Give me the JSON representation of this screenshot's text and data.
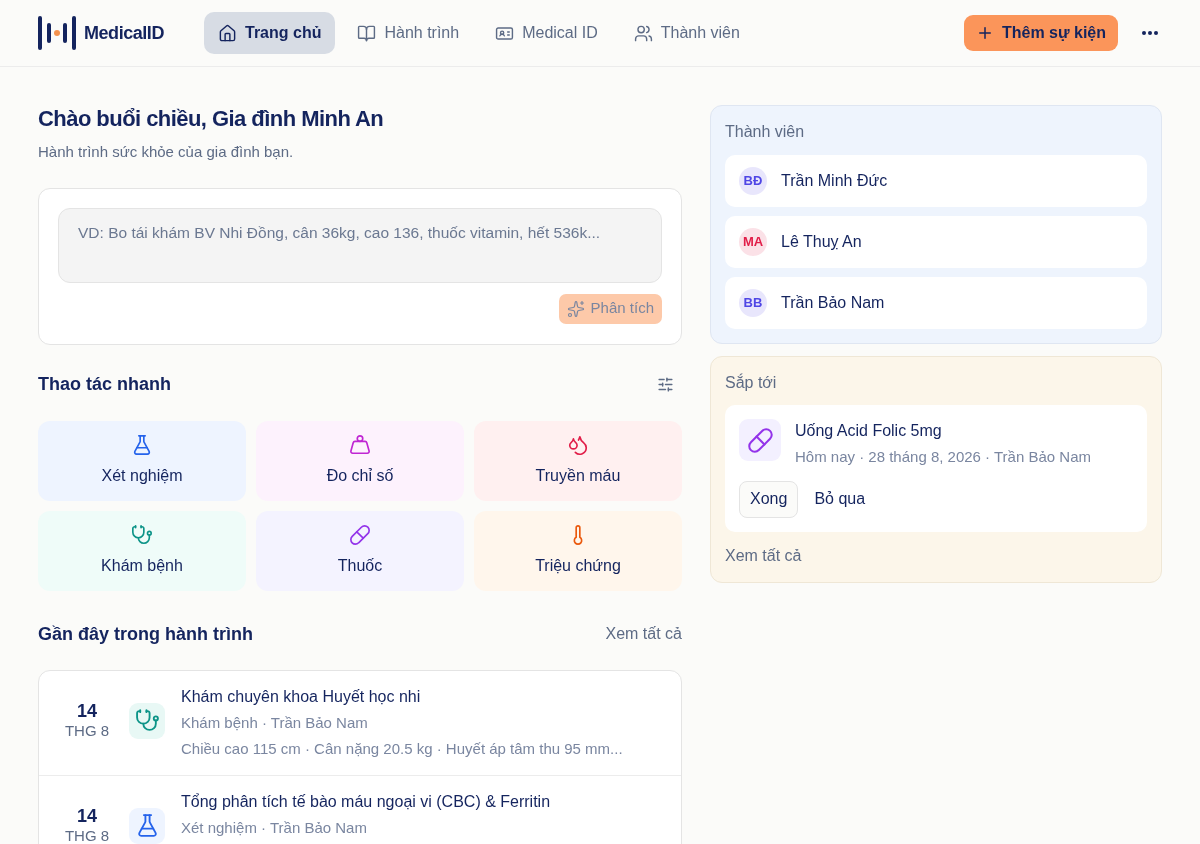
{
  "brand": {
    "name": "MedicalID"
  },
  "nav": [
    {
      "label": "Trang chủ",
      "kind": "home",
      "selected": true
    },
    {
      "label": "Hành trình",
      "kind": "journey",
      "selected": false
    },
    {
      "label": "Medical ID",
      "kind": "id",
      "selected": false
    },
    {
      "label": "Thành viên",
      "kind": "members",
      "selected": false
    }
  ],
  "add_button": "Thêm sự kiện",
  "greeting": {
    "title": "Chào buổi chiều, Gia đình Minh An",
    "subtitle": "Hành trình sức khỏe của gia đình bạn."
  },
  "composer": {
    "placeholder": "VD: Bo tái khám BV Nhi Đồng, cân 36kg, cao 136, thuốc vitamin, hết 536k...",
    "analyze_button": "Phân tích",
    "analyze_disabled": true
  },
  "quick_actions": {
    "title": "Thao tác nhanh",
    "items": [
      {
        "label": "Xét nghiệm",
        "kind": "lab"
      },
      {
        "label": "Đo chỉ số",
        "kind": "measure"
      },
      {
        "label": "Truyền máu",
        "kind": "blood"
      },
      {
        "label": "Khám bệnh",
        "kind": "visit"
      },
      {
        "label": "Thuốc",
        "kind": "medicine"
      },
      {
        "label": "Triệu chứng",
        "kind": "symptom"
      }
    ]
  },
  "recent": {
    "title": "Gần đây trong hành trình",
    "see_all": "Xem tất cả",
    "items": [
      {
        "day": "14",
        "month": "THG 8",
        "kind": "visit",
        "title": "Khám chuyên khoa Huyết học nhi",
        "meta": "Khám bệnh · Trần Bảo Nam",
        "detail": "Chiều cao 115 cm · Cân nặng 20.5 kg · Huyết áp tâm thu 95 mm..."
      },
      {
        "day": "14",
        "month": "THG 8",
        "kind": "lab",
        "title": "Tổng phân tích tế bào máu ngoại vi (CBC) & Ferritin",
        "meta": "Xét nghiệm · Trần Bảo Nam"
      }
    ]
  },
  "members": {
    "title": "Thành viên",
    "items": [
      {
        "initials": "BĐ",
        "name": "Trần Minh Đức",
        "color": "#4f46e5"
      },
      {
        "initials": "MA",
        "name": "Lê Thuỵ An",
        "color": "#e11d48"
      },
      {
        "initials": "BB",
        "name": "Trần Bảo Nam",
        "color": "#4f46e5"
      }
    ]
  },
  "upcoming": {
    "title": "Sắp tới",
    "items": [
      {
        "kind": "medicine",
        "title": "Uống Acid Folic 5mg",
        "meta": "Hôm nay · 28 tháng 8, 2026 · Trần Bảo Nam",
        "done_button": "Xong",
        "skip_button": "Bỏ qua"
      }
    ],
    "see_all": "Xem tất cả"
  }
}
